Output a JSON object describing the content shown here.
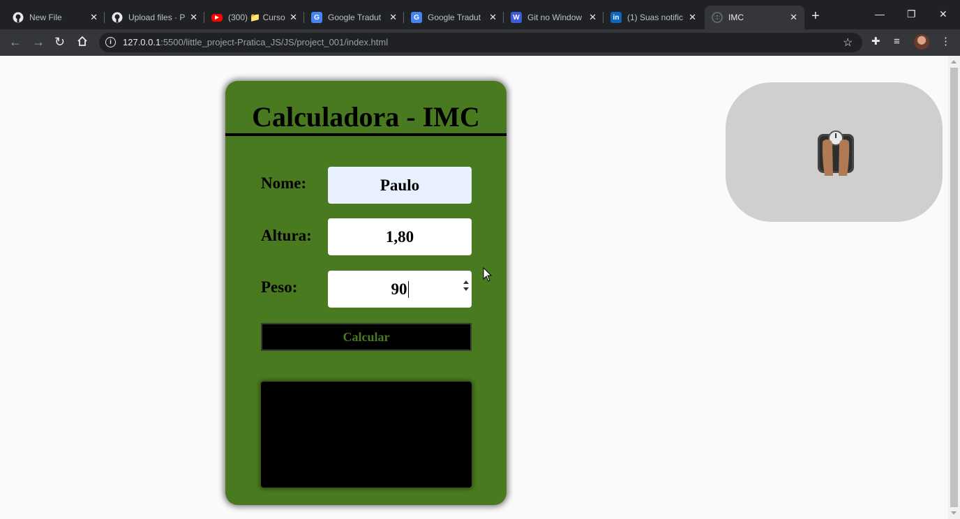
{
  "browser": {
    "tabs": [
      {
        "title": "New File",
        "icon": "github-icon"
      },
      {
        "title": "Upload files · P",
        "icon": "github-icon"
      },
      {
        "title": "(300) 📁 Curso",
        "icon": "youtube-icon"
      },
      {
        "title": "Google Tradut",
        "icon": "google-translate-icon"
      },
      {
        "title": "Google Tradut",
        "icon": "google-translate-icon"
      },
      {
        "title": "Git no Window",
        "icon": "w-icon"
      },
      {
        "title": "(1) Suas notific",
        "icon": "linkedin-icon"
      },
      {
        "title": "IMC",
        "icon": "globe-icon"
      }
    ],
    "url_host": "127.0.0.1",
    "url_path": ":5500/little_project-Pratica_JS/JS/project_001/index.html"
  },
  "app": {
    "title": "Calculadora - IMC",
    "fields": {
      "nome": {
        "label": "Nome:",
        "value": "Paulo"
      },
      "altura": {
        "label": "Altura:",
        "value": "1,80"
      },
      "peso": {
        "label": "Peso:",
        "value": "90"
      }
    },
    "button_label": "Calcular",
    "result": ""
  },
  "colors": {
    "card_green": "#4a7a1f",
    "panel_gray": "#cfcfcf"
  }
}
